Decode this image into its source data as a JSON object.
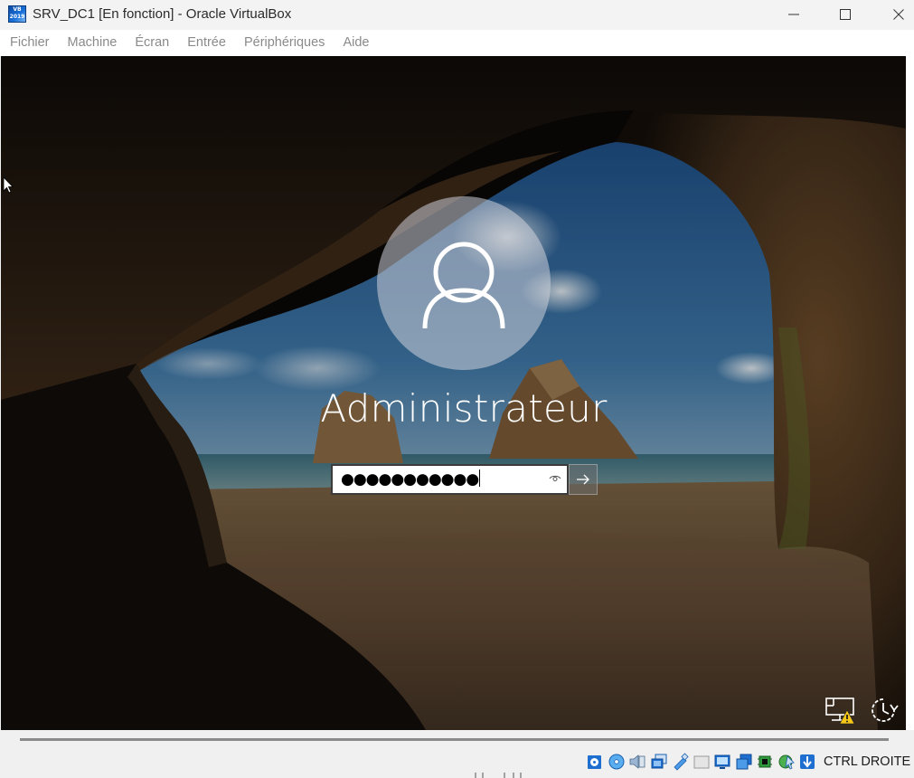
{
  "window": {
    "title": "SRV_DC1 [En fonction] - Oracle VirtualBox",
    "app_icon": "virtualbox-vm-icon",
    "controls": [
      "minimize-icon",
      "maximize-icon",
      "close-icon"
    ]
  },
  "menubar": {
    "items": [
      {
        "label": "Fichier"
      },
      {
        "label": "Machine"
      },
      {
        "label": "Écran"
      },
      {
        "label": "Entrée"
      },
      {
        "label": "Périphériques"
      },
      {
        "label": "Aide"
      }
    ]
  },
  "login": {
    "username": "Administrateur",
    "password_mask": "●●●●●●●●●●●",
    "avatar_icon": "user-avatar-icon",
    "reveal_icon": "eye-icon",
    "submit_icon": "arrow-right-icon"
  },
  "corner_icons": [
    "network-warning-icon",
    "power-icon"
  ],
  "statusbar": {
    "icons": [
      "hard-disk-icon",
      "optical-drive-icon",
      "audio-icon",
      "network-adapter-icon",
      "usb-icon",
      "shared-folders-icon",
      "display-icon",
      "recording-icon",
      "cpu-icon",
      "mouse-integration-icon",
      "keyboard-capture-icon"
    ],
    "host_key": "CTRL DROITE"
  },
  "colors": {
    "accent": "#0b62c4",
    "titlebar_bg": "#f3f3f3",
    "menu_text": "#8a8a8a"
  }
}
